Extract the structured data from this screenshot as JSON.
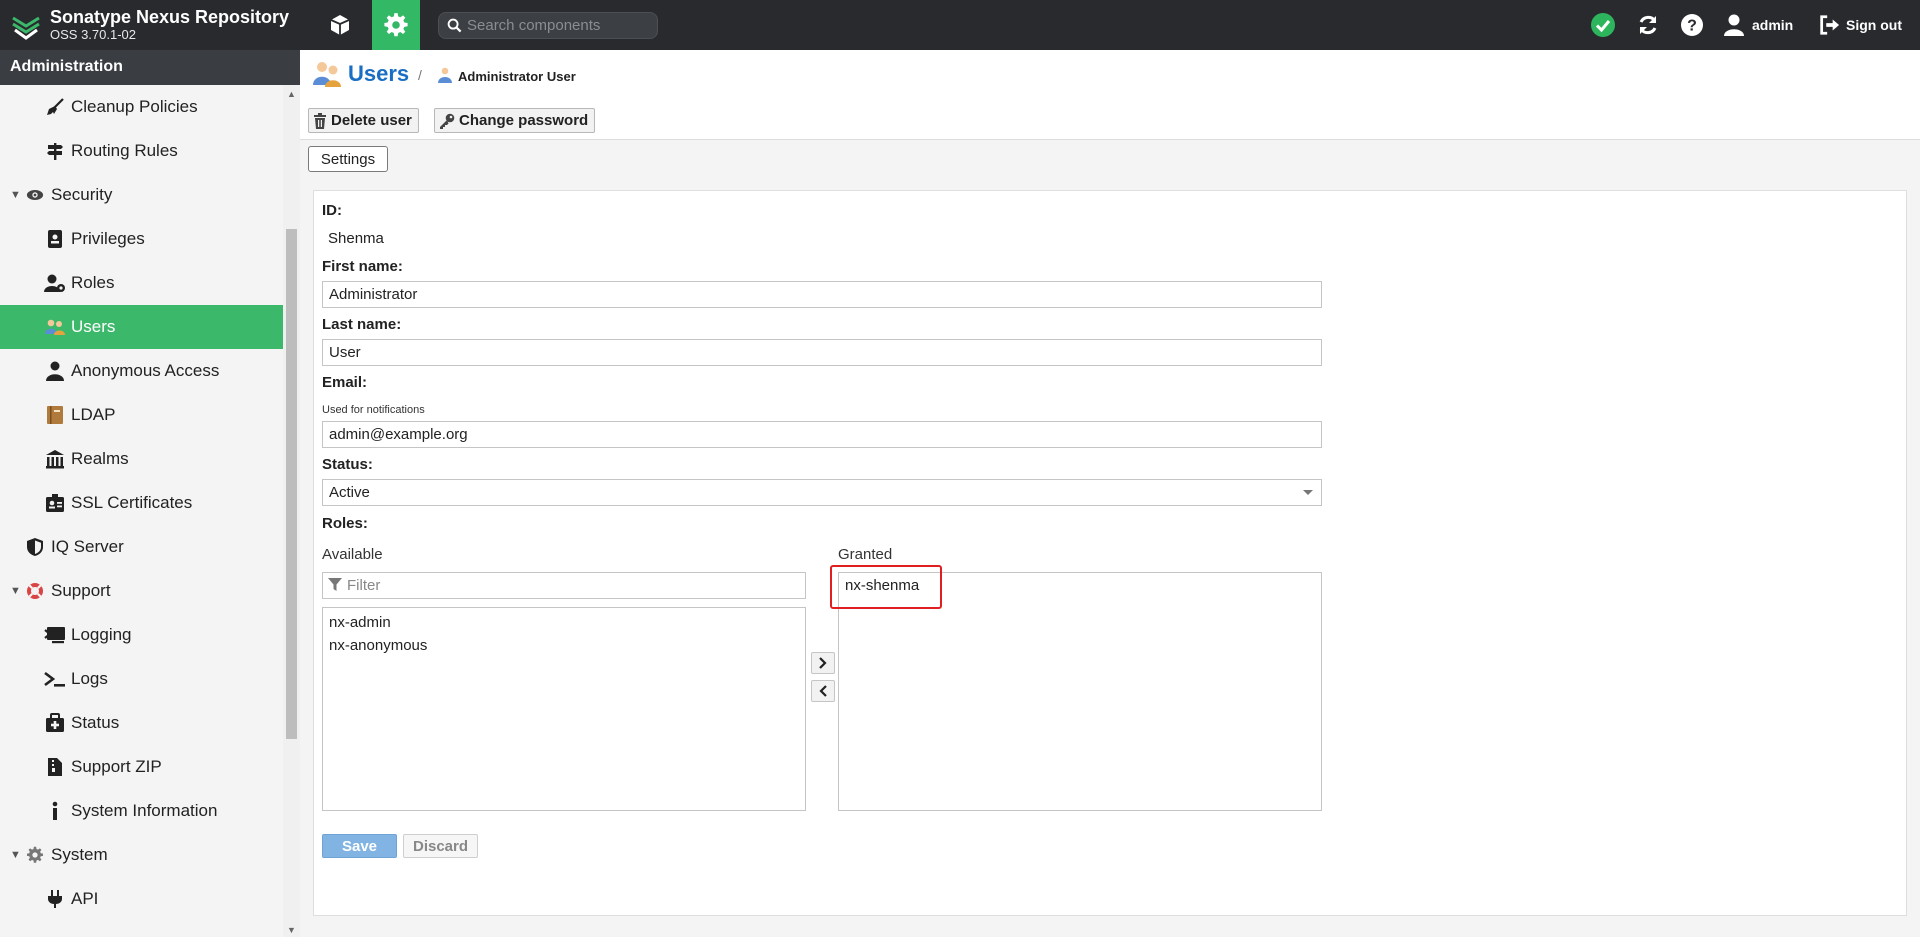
{
  "app": {
    "title": "Sonatype Nexus Repository",
    "version": "OSS 3.70.1-02"
  },
  "header": {
    "search_placeholder": "Search components",
    "user_label": "admin",
    "signout_label": "Sign out",
    "status_color": "#2db55d",
    "icons": [
      "browse-cube-icon",
      "admin-gear-icon",
      "status-check-icon",
      "refresh-icon",
      "help-icon",
      "user-icon",
      "signout-icon"
    ]
  },
  "sidebar": {
    "heading": "Administration",
    "items": [
      {
        "label": "Cleanup Policies",
        "icon": "broom-icon"
      },
      {
        "label": "Routing Rules",
        "icon": "signpost-icon"
      },
      {
        "label": "Security",
        "icon": "eye-icon",
        "expanded": true
      },
      {
        "label": "Privileges",
        "icon": "id-badge-icon"
      },
      {
        "label": "Roles",
        "icon": "user-gear-icon"
      },
      {
        "label": "Users",
        "icon": "users-icon",
        "active": true
      },
      {
        "label": "Anonymous Access",
        "icon": "person-icon"
      },
      {
        "label": "LDAP",
        "icon": "book-icon"
      },
      {
        "label": "Realms",
        "icon": "building-icon"
      },
      {
        "label": "SSL Certificates",
        "icon": "certificate-icon"
      },
      {
        "label": "IQ Server",
        "icon": "shield-icon"
      },
      {
        "label": "Support",
        "icon": "lifebuoy-icon",
        "expanded": true
      },
      {
        "label": "Logging",
        "icon": "terminal-icon"
      },
      {
        "label": "Logs",
        "icon": "prompt-icon"
      },
      {
        "label": "Status",
        "icon": "medkit-icon"
      },
      {
        "label": "Support ZIP",
        "icon": "file-zip-icon"
      },
      {
        "label": "System Information",
        "icon": "info-icon"
      },
      {
        "label": "System",
        "icon": "cog-icon",
        "expanded": true
      },
      {
        "label": "API",
        "icon": "plug-icon"
      }
    ]
  },
  "breadcrumb": {
    "title": "Users",
    "separator": "/",
    "current": "Administrator User"
  },
  "actions": {
    "delete_label": "Delete user",
    "change_password_label": "Change password"
  },
  "tabs": {
    "settings_label": "Settings"
  },
  "form": {
    "id_label": "ID:",
    "id_value": "Shenma",
    "first_name_label": "First name:",
    "first_name_value": "Administrator",
    "last_name_label": "Last name:",
    "last_name_value": "User",
    "email_label": "Email:",
    "email_help": "Used for notifications",
    "email_value": "admin@example.org",
    "status_label": "Status:",
    "status_value": "Active",
    "roles_label": "Roles:",
    "available_label": "Available",
    "granted_label": "Granted",
    "filter_placeholder": "Filter",
    "available_roles": [
      "nx-admin",
      "nx-anonymous"
    ],
    "granted_roles": [
      "nx-shenma"
    ],
    "save_label": "Save",
    "discard_label": "Discard"
  },
  "colors": {
    "accent": "#3cb86a",
    "header_bg": "#282a2e",
    "link": "#1a6fc4",
    "highlight": "#e02020"
  }
}
